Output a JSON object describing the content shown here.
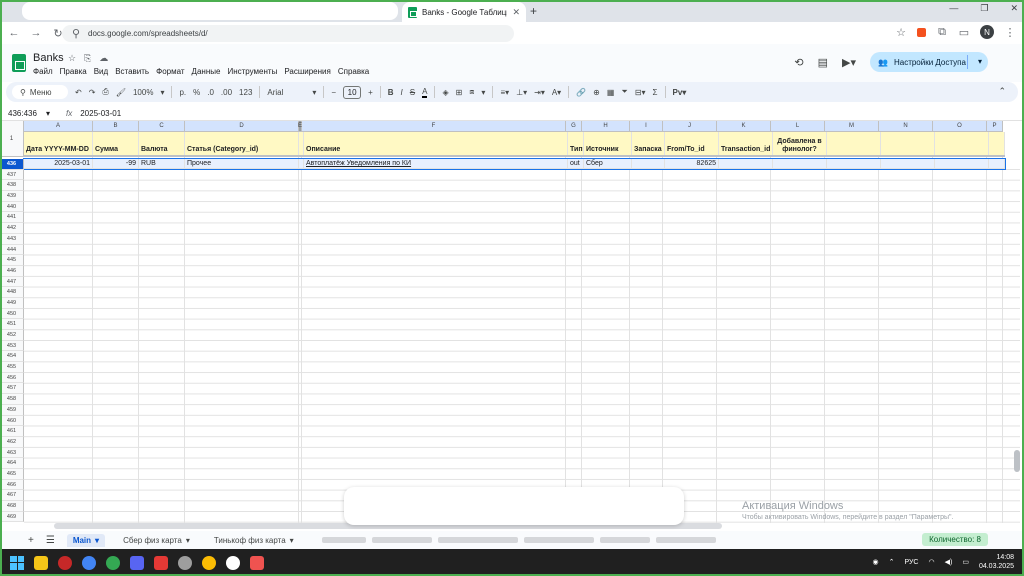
{
  "browser": {
    "tab_title": "Banks - Google Таблицы",
    "url": "docs.google.com/spreadsheets/d/"
  },
  "doc": {
    "title": "Banks",
    "menu": [
      "Файл",
      "Правка",
      "Вид",
      "Вставить",
      "Формат",
      "Данные",
      "Инструменты",
      "Расширения",
      "Справка"
    ],
    "share_label": "Настройки Доступа",
    "avatar_letter": "N"
  },
  "toolbar": {
    "menu_search": "Меню",
    "zoom": "100%",
    "currency": "р.",
    "percent": "%",
    "dec_decrease": ".0",
    "dec_increase": ".00",
    "format_123": "123",
    "font": "Arial",
    "font_size": "10"
  },
  "formula_bar": {
    "range": "436:436",
    "fx": "fx",
    "value": "2025-03-01"
  },
  "grid": {
    "columns": [
      "A",
      "B",
      "C",
      "D",
      "E",
      "F",
      "G",
      "H",
      "I",
      "J",
      "K",
      "L",
      "M",
      "N",
      "O",
      "P"
    ],
    "corner_label": "1",
    "headers": [
      "Дата YYYY-MM-DD",
      "Сумма",
      "Валюта",
      "Статья (Category_id)",
      "",
      "Описание",
      "Тип",
      "Источник",
      "Запаска",
      "From/To_id",
      "Transaction_id",
      "Добавлена в финолог?",
      "",
      "",
      "",
      ""
    ],
    "selected_row": {
      "row_number": "436",
      "cells": [
        "2025-03-01",
        "-99",
        "RUB",
        "Прочее",
        "",
        "Автоплатёж Уведомления по КИ",
        "out",
        "Сбер",
        "",
        "82625",
        "",
        "",
        "",
        "",
        "",
        ""
      ]
    },
    "row_numbers": [
      "436",
      "437",
      "438",
      "439",
      "440",
      "441",
      "442",
      "443",
      "444",
      "445",
      "446",
      "447",
      "448",
      "449",
      "450",
      "451",
      "452",
      "453",
      "454",
      "455",
      "456",
      "457",
      "458",
      "459",
      "460",
      "461",
      "462",
      "463",
      "464",
      "465",
      "466",
      "467",
      "468",
      "469"
    ]
  },
  "sheets": {
    "tabs": [
      "Main",
      "Сбер физ карта",
      "Тинькоф физ карта"
    ],
    "active": "Main",
    "count_label": "Количество: 8"
  },
  "activation": {
    "title": "Активация Windows",
    "subtitle": "Чтобы активировать Windows, перейдите в раздел \"Параметры\"."
  },
  "taskbar": {
    "lang": "РУС",
    "time": "14:08",
    "date": "04.03.2025"
  },
  "colors": {
    "accent": "#0b57d0",
    "header_fill": "#fff9c4",
    "sheets_green": "#0f9d58",
    "share_btn": "#c2e7ff"
  }
}
